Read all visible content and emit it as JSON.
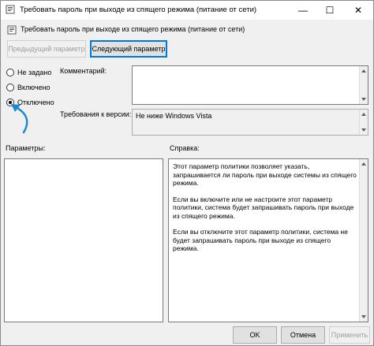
{
  "window": {
    "title": "Требовать пароль при выходе из спящего режима (питание от сети)",
    "minimize_glyph": "—",
    "maximize_glyph": "☐",
    "close_glyph": "✕"
  },
  "header": {
    "policy_name": "Требовать пароль при выходе из спящего режима (питание от сети)"
  },
  "nav": {
    "prev_label": "Предыдущий параметр",
    "next_label": "Следующий параметр"
  },
  "state": {
    "options": [
      "Не задано",
      "Включено",
      "Отключено"
    ],
    "selected": "Отключено"
  },
  "comment": {
    "label": "Комментарий:",
    "value": ""
  },
  "supported": {
    "label": "Требования к версии:",
    "value": "Не ниже Windows Vista"
  },
  "sections": {
    "params_label": "Параметры:",
    "help_label": "Справка:"
  },
  "help": {
    "p1": "Этот параметр политики позволяет указать, запрашивается ли пароль при выходе системы из спящего режима.",
    "p2": "Если вы включите или не настроите этот параметр политики, система будет запрашивать пароль при выходе из спящего режима.",
    "p3": "Если вы отключите этот параметр политики, система не будет запрашивать пароль при выходе из спящего режима."
  },
  "footer": {
    "ok_label": "OK",
    "cancel_label": "Отмена",
    "apply_label": "Применить"
  },
  "colors": {
    "accent": "#0078d7",
    "annotation_arrow": "#1e88d0"
  }
}
